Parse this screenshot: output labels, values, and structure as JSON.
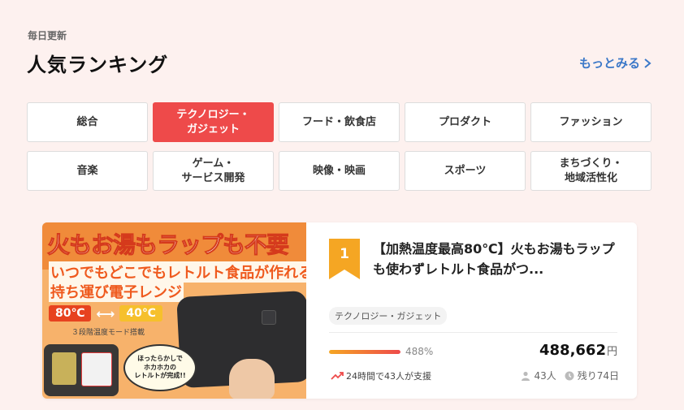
{
  "header": {
    "daily_label": "毎日更新",
    "title": "人気ランキング",
    "more_label": "もっとみる"
  },
  "categories": [
    {
      "label": "総合",
      "active": false
    },
    {
      "label": "テクノロジー・\nガジェット",
      "active": true
    },
    {
      "label": "フード・飲食店",
      "active": false
    },
    {
      "label": "プロダクト",
      "active": false
    },
    {
      "label": "ファッション",
      "active": false
    },
    {
      "label": "音楽",
      "active": false
    },
    {
      "label": "ゲーム・\nサービス開発",
      "active": false
    },
    {
      "label": "映像・映画",
      "active": false
    },
    {
      "label": "スポーツ",
      "active": false
    },
    {
      "label": "まちづくり・\n地域活性化",
      "active": false
    }
  ],
  "project": {
    "rank": "1",
    "title": "【加熱温度最高80℃】火もお湯もラップも使わずレトルト食品がつ...",
    "tag": "テクノロジー・ガジェット",
    "percent": "488%",
    "progress_fraction": 1.0,
    "amount": "488,662",
    "currency": "円",
    "trend": "24時間で43人が支援",
    "supporters": "43人",
    "remaining": "残り74日",
    "thumb": {
      "line1": "火もお湯もラップも不要",
      "line2": "いつでもどこでもレトルト食品が作れる",
      "line3": "持ち運び電子レンジ",
      "temp_high": "80℃",
      "temp_low": "40℃",
      "mode": "３段階温度モード搭載",
      "bubble": "ほったらかしで\nホカホカの\nレトルトが完成!!"
    }
  },
  "colors": {
    "accent_red": "#ee4a4a",
    "link_blue": "#3b78c8",
    "rank_gold": "#f5a623"
  }
}
